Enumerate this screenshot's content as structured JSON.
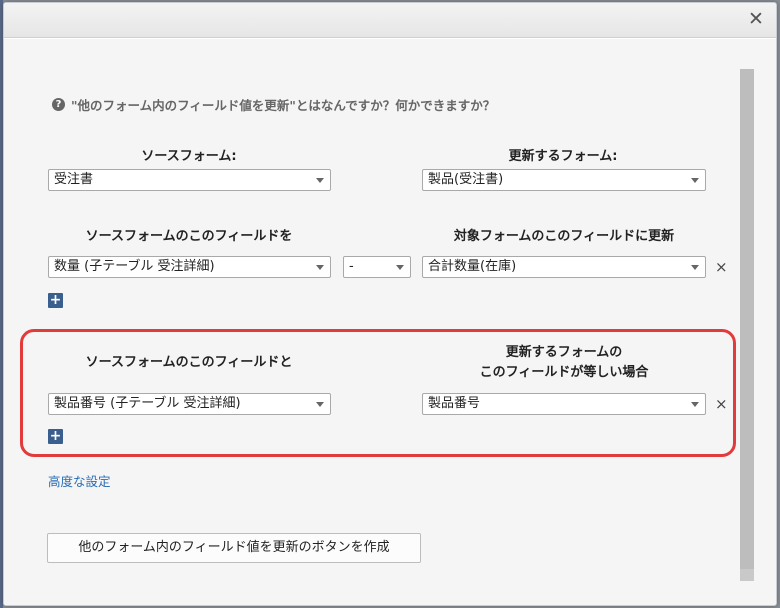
{
  "help_text": "\"他のフォーム内のフィールド値を更新\"とはなんですか？何かできますか？",
  "icons": {
    "close": "close-icon",
    "help": "question-circle-icon",
    "add": "plus-icon",
    "remove": "x-icon"
  },
  "help_icon_glyph": "?",
  "close_glyph": "✕",
  "source_form": {
    "label": "ソースフォーム:",
    "value": "受注書"
  },
  "target_form": {
    "label": "更新するフォーム:",
    "value": "製品(受注書)"
  },
  "mapping": {
    "source_label": "ソースフォームのこのフィールドを",
    "target_label": "対象フォームのこのフィールドに更新",
    "source_value": "数量 (子テーブル 受注詳細)",
    "operator_value": "-",
    "target_value": "合計数量(在庫)",
    "remove_glyph": "×",
    "add_glyph": "+"
  },
  "match": {
    "source_label": "ソースフォームのこのフィールドと",
    "target_label_line1": "更新するフォームの",
    "target_label_line2": "このフィールドが等しい場合",
    "source_value": "製品番号 (子テーブル 受注詳細)",
    "target_value": "製品番号",
    "remove_glyph": "×",
    "add_glyph": "+"
  },
  "advanced_link": "高度な設定",
  "create_button": "他のフォーム内のフィールド値を更新のボタンを作成",
  "colors": {
    "highlight": "#e23b3b",
    "plus_button": "#3a5f8f",
    "link": "#2a6db5"
  }
}
